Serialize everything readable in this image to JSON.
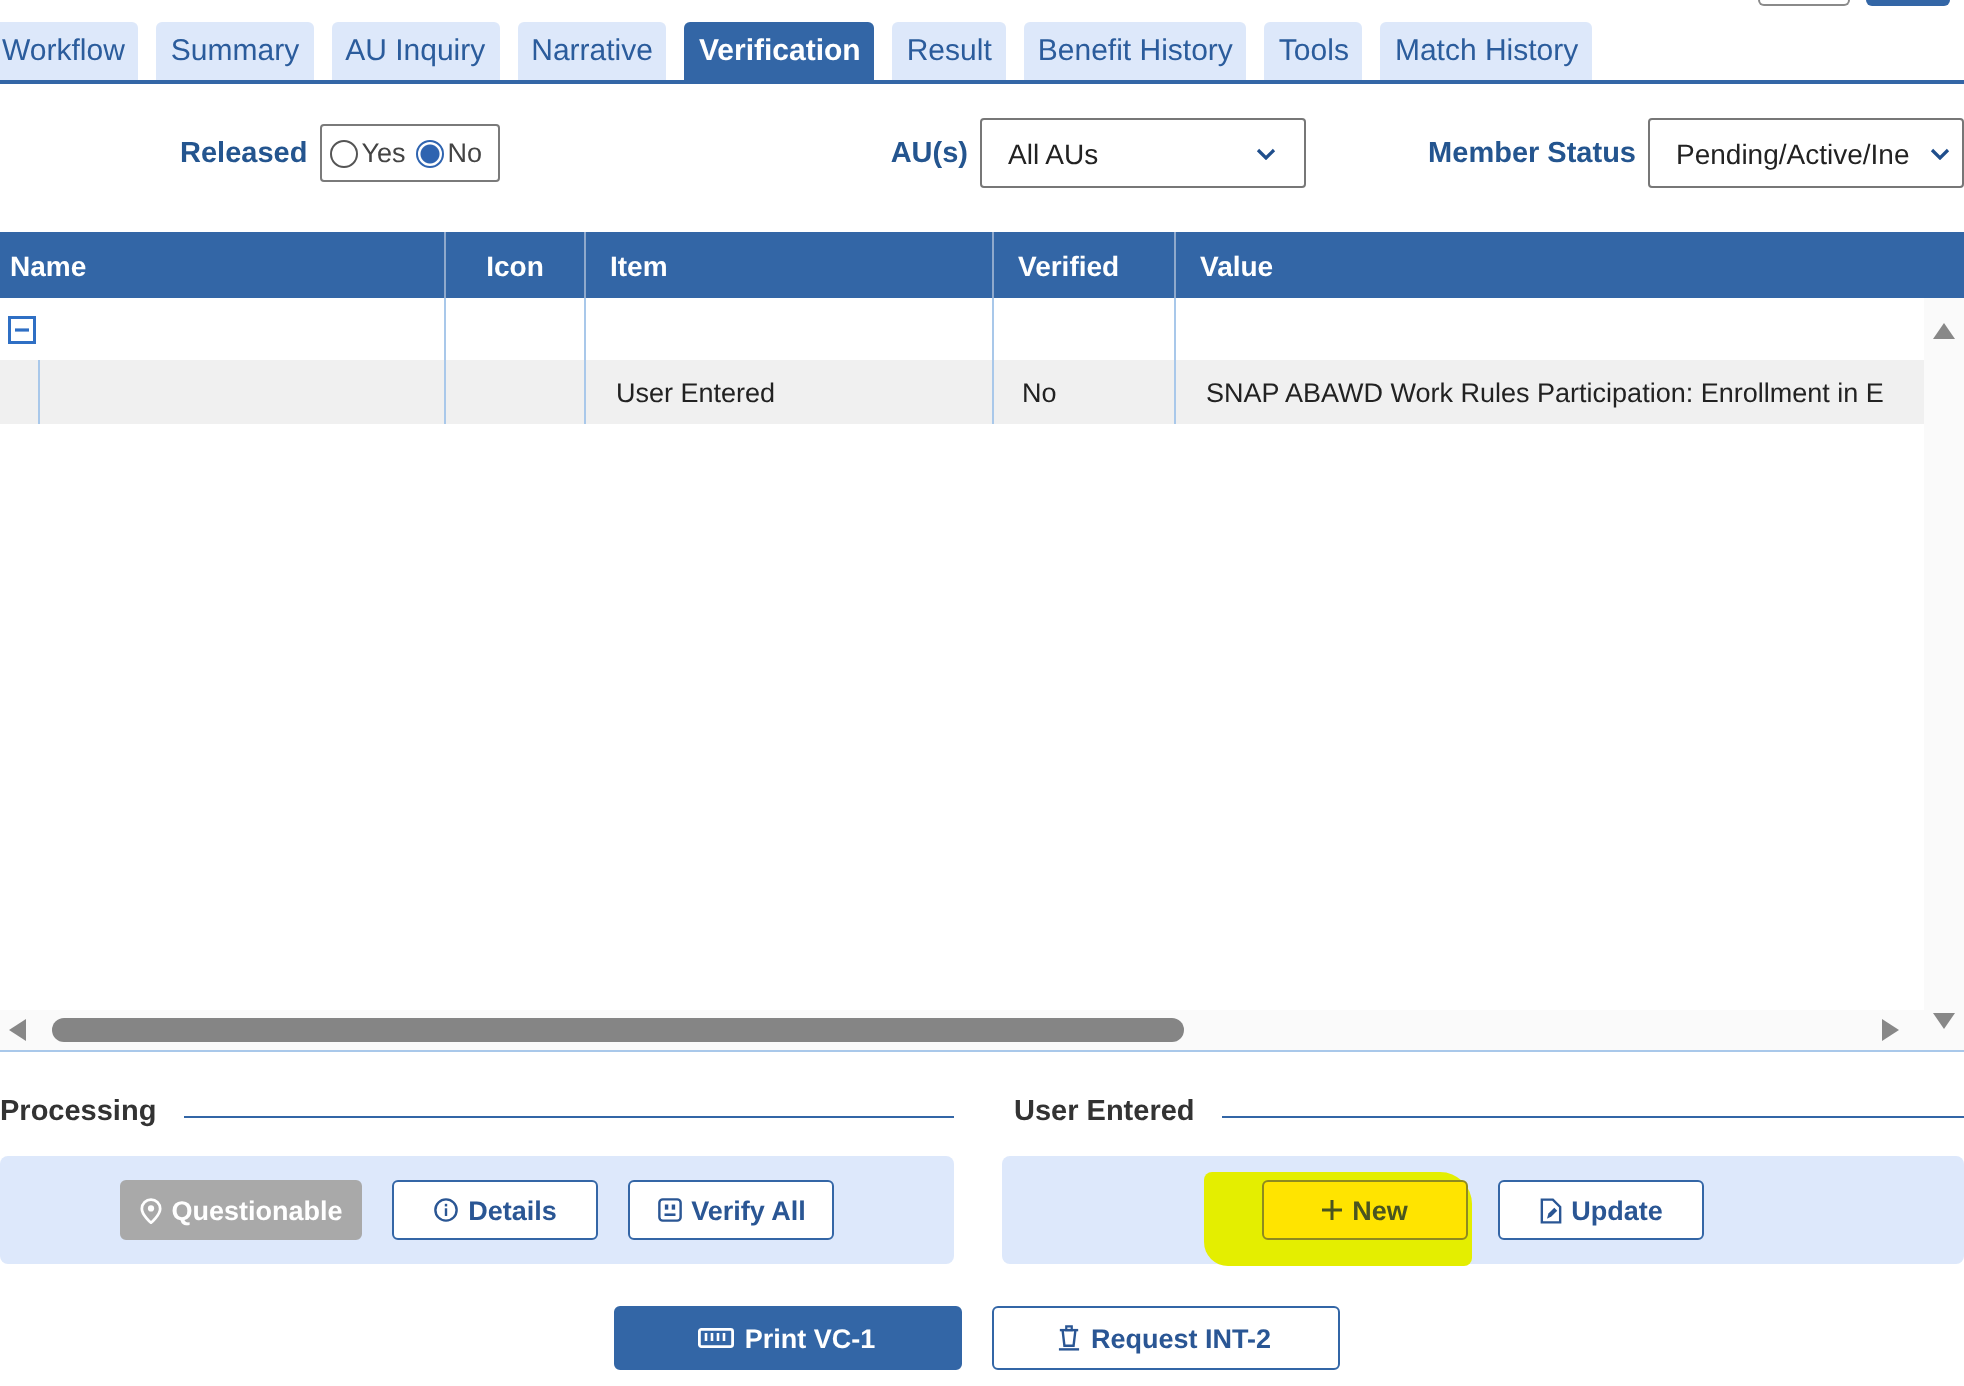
{
  "tabs": [
    {
      "label": "Workflow",
      "selected": false
    },
    {
      "label": "Summary",
      "selected": false
    },
    {
      "label": "AU Inquiry",
      "selected": false
    },
    {
      "label": "Narrative",
      "selected": false
    },
    {
      "label": "Verification",
      "selected": true
    },
    {
      "label": "Result",
      "selected": false
    },
    {
      "label": "Benefit History",
      "selected": false
    },
    {
      "label": "Tools",
      "selected": false
    },
    {
      "label": "Match History",
      "selected": false
    }
  ],
  "filters": {
    "released": {
      "label": "Released",
      "options": [
        {
          "label": "Yes",
          "selected": false
        },
        {
          "label": "No",
          "selected": true
        }
      ]
    },
    "au": {
      "label": "AU(s)",
      "value": "All AUs"
    },
    "member_status": {
      "label": "Member Status",
      "value": "Pending/Active/Ine"
    }
  },
  "table": {
    "columns": [
      "Name",
      "Icon",
      "Item",
      "Verified",
      "Value"
    ],
    "groups": [
      {
        "expanded": true,
        "rows": [
          {
            "item": "User Entered",
            "verified": "No",
            "value": "SNAP ABAWD Work Rules Participation: Enrollment in E"
          }
        ]
      }
    ]
  },
  "processing": {
    "title": "Processing",
    "buttons": [
      {
        "label": "Questionable",
        "disabled": true
      },
      {
        "label": "Details",
        "disabled": false
      },
      {
        "label": "Verify All",
        "disabled": false
      }
    ]
  },
  "user_entered": {
    "title": "User Entered",
    "buttons": [
      {
        "label": "New",
        "highlighted": true
      },
      {
        "label": "Update",
        "highlighted": false
      }
    ]
  },
  "actions": [
    {
      "label": "Print VC-1",
      "kind": "primary"
    },
    {
      "label": "Request INT-2",
      "kind": "secondary"
    }
  ]
}
